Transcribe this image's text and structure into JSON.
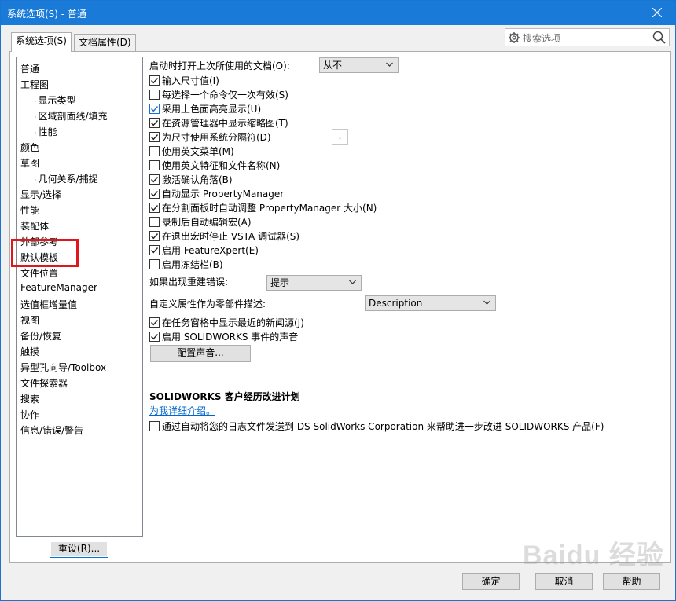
{
  "window": {
    "title": "系统选项(S) - 普通"
  },
  "tabs": [
    {
      "label": "系统选项(S)"
    },
    {
      "label": "文档属性(D)"
    }
  ],
  "search": {
    "placeholder": "搜索选项"
  },
  "tree": {
    "items": [
      {
        "label": "普通",
        "level": 0
      },
      {
        "label": "工程图",
        "level": 0
      },
      {
        "label": "显示类型",
        "level": 1
      },
      {
        "label": "区域剖面线/填充",
        "level": 1
      },
      {
        "label": "性能",
        "level": 1
      },
      {
        "label": "颜色",
        "level": 0
      },
      {
        "label": "草图",
        "level": 0
      },
      {
        "label": "几何关系/捕捉",
        "level": 1
      },
      {
        "label": "显示/选择",
        "level": 0
      },
      {
        "label": "性能",
        "level": 0
      },
      {
        "label": "装配体",
        "level": 0
      },
      {
        "label": "外部参考",
        "level": 0
      },
      {
        "label": "默认模板",
        "level": 0
      },
      {
        "label": "文件位置",
        "level": 0
      },
      {
        "label": "FeatureManager",
        "level": 0
      },
      {
        "label": "选值框增量值",
        "level": 0
      },
      {
        "label": "视图",
        "level": 0
      },
      {
        "label": "备份/恢复",
        "level": 0
      },
      {
        "label": "触摸",
        "level": 0
      },
      {
        "label": "异型孔向导/Toolbox",
        "level": 0
      },
      {
        "label": "文件探索器",
        "level": 0
      },
      {
        "label": "搜索",
        "level": 0
      },
      {
        "label": "协作",
        "level": 0
      },
      {
        "label": "信息/错误/警告",
        "level": 0
      }
    ],
    "highlighted": "默认模板"
  },
  "reset_button": "重设(R)...",
  "options": {
    "open_last_label": "启动时打开上次所使用的文档(O):",
    "open_last_value": "从不",
    "checkboxes": [
      {
        "label": "输入尺寸值(I)",
        "checked": true
      },
      {
        "label": "每选择一个命令仅一次有效(S)",
        "checked": false
      },
      {
        "label": "采用上色面高亮显示(U)",
        "checked": true
      },
      {
        "label": "在资源管理器中显示缩略图(T)",
        "checked": true
      },
      {
        "label": "为尺寸使用系统分隔符(D)",
        "checked": true
      },
      {
        "label": "使用英文菜单(M)",
        "checked": false
      },
      {
        "label": "使用英文特征和文件名称(N)",
        "checked": false
      },
      {
        "label": "激活确认角落(B)",
        "checked": true
      },
      {
        "label": "自动显示 PropertyManager",
        "checked": true
      },
      {
        "label": "在分割面板时自动调整 PropertyManager 大小(N)",
        "checked": true
      },
      {
        "label": "录制后自动编辑宏(A)",
        "checked": false
      },
      {
        "label": "在退出宏时停止 VSTA 调试器(S)",
        "checked": true
      },
      {
        "label": "启用 FeatureXpert(E)",
        "checked": true
      },
      {
        "label": "启用冻结栏(B)",
        "checked": false
      }
    ],
    "separator_value": ".",
    "rebuild_error_label": "如果出现重建错误:",
    "rebuild_error_value": "提示",
    "custom_prop_label": "自定义属性作为零部件描述:",
    "custom_prop_value": "Description",
    "checkboxes2": [
      {
        "label": "在任务窗格中显示最近的新闻源(J)",
        "checked": true
      },
      {
        "label": "启用 SOLIDWORKS 事件的声音",
        "checked": true
      }
    ],
    "sound_button": "配置声音..."
  },
  "ceip": {
    "heading": "SOLIDWORKS 客户经历改进计划",
    "link": "为我详细介绍。",
    "checkbox_label": "通过自动将您的日志文件发送到 DS SolidWorks Corporation 来帮助进一步改进 SOLIDWORKS 产品(F)",
    "checked": false
  },
  "buttons": {
    "ok": "确定",
    "cancel": "取消",
    "help": "帮助"
  },
  "watermark": {
    "text": "Baidu 经验"
  }
}
